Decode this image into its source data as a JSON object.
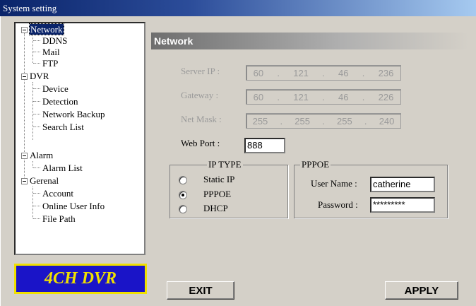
{
  "window": {
    "title": "System setting"
  },
  "tree": {
    "network": {
      "label": "Network",
      "children": [
        "DDNS",
        "Mail",
        "FTP"
      ]
    },
    "dvr": {
      "label": "DVR",
      "children": [
        "Device",
        "Detection",
        "Network Backup",
        "Search List"
      ]
    },
    "alarm": {
      "label": "Alarm",
      "children": [
        "Alarm List"
      ]
    },
    "general": {
      "label": "Gerenal",
      "children": [
        "Account",
        "Online User Info",
        "File Path"
      ]
    }
  },
  "logo": {
    "text": "4CH DVR"
  },
  "panel": {
    "title": "Network"
  },
  "fields": {
    "server_ip": {
      "label": "Server IP :",
      "octets": [
        "60",
        "121",
        "46",
        "236"
      ]
    },
    "gateway": {
      "label": "Gateway :",
      "octets": [
        "60",
        "121",
        "46",
        "226"
      ]
    },
    "net_mask": {
      "label": "Net Mask :",
      "octets": [
        "255",
        "255",
        "255",
        "240"
      ]
    },
    "web_port": {
      "label": "Web Port :",
      "value": "888"
    }
  },
  "ip_type": {
    "title": "IP TYPE",
    "options": [
      "Static IP",
      "PPPOE",
      "DHCP"
    ],
    "selected": "PPPOE"
  },
  "pppoe": {
    "title": "PPPOE",
    "user_label": "User Name :",
    "user_value": "catherine",
    "password_label": "Password :",
    "password_value": "*********"
  },
  "buttons": {
    "exit": "EXIT",
    "apply": "APPLY"
  }
}
